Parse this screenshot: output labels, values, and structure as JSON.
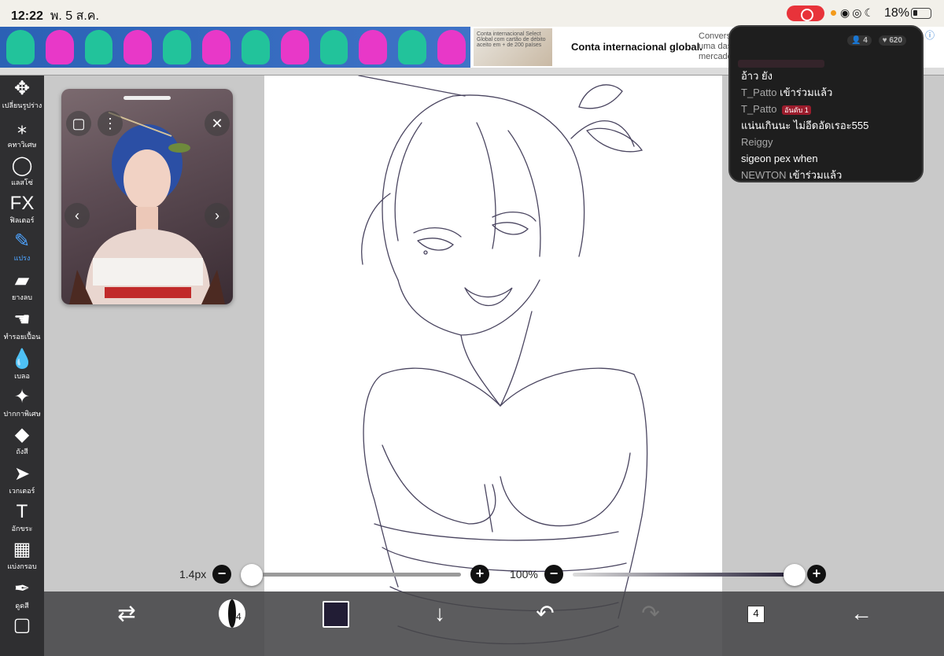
{
  "status_bar": {
    "time": "12:22",
    "date": "พ. 5 ส.ค.",
    "battery": "18%",
    "icons": [
      "record-icon",
      "wifi-icon",
      "lock-rotation-icon",
      "moon-icon",
      "battery-icon"
    ]
  },
  "ad": {
    "thumb_text": "Conta internacional Select Global com cartão de débito aceito em + de 200 países",
    "title": "Conta internacional global.",
    "subtitle": "Conversa uma das mercado",
    "gummy_colors": [
      "#22c39b",
      "#e838c8",
      "#22c39b",
      "#e838c8",
      "#22c39b",
      "#e838c8",
      "#22c39b",
      "#e838c8",
      "#22c39b",
      "#e838c8",
      "#22c39b",
      "#e838c8"
    ]
  },
  "toolbar": {
    "tools": [
      {
        "label": "เปลี่ยนรูปร่าง",
        "glyph": "✥",
        "icon": "move-icon"
      },
      {
        "label": "คทาวิเศษ",
        "glyph": "⁎",
        "icon": "magic-wand-icon"
      },
      {
        "label": "แลสโซ่",
        "glyph": "◯",
        "icon": "lasso-icon"
      },
      {
        "label": "ฟิลเตอร์",
        "glyph": "FX",
        "icon": "fx-icon"
      },
      {
        "label": "แปรง",
        "glyph": "✎",
        "icon": "brush-icon",
        "active": true
      },
      {
        "label": "ยางลบ",
        "glyph": "▰",
        "icon": "eraser-icon"
      },
      {
        "label": "ทำรอยเปื้อน",
        "glyph": "☚",
        "icon": "smudge-icon"
      },
      {
        "label": "เบลอ",
        "glyph": "💧",
        "icon": "blur-icon"
      },
      {
        "label": "ปากกาพิเศษ",
        "glyph": "✦",
        "icon": "special-pen-icon"
      },
      {
        "label": "ถังสี",
        "glyph": "◆",
        "icon": "bucket-icon"
      },
      {
        "label": "เวกเตอร์",
        "glyph": "➤",
        "icon": "vector-icon"
      },
      {
        "label": "อักขระ",
        "glyph": "T",
        "icon": "text-icon"
      },
      {
        "label": "แบ่งกรอบ",
        "glyph": "▦",
        "icon": "frame-divider-icon"
      },
      {
        "label": "ดูดสี",
        "glyph": "✒",
        "icon": "eyedropper-icon"
      },
      {
        "label": "",
        "glyph": "▢",
        "icon": "canvas-icon"
      }
    ]
  },
  "sliders": {
    "brush_size": "1.4px",
    "brush_size_fraction": 0.0,
    "opacity": "100%",
    "opacity_fraction": 1.0
  },
  "bottom_bar": {
    "brush_size_value": "1.4",
    "layer_count": "4",
    "color": "#221d35"
  },
  "chat": {
    "viewers": "4",
    "likes": "620",
    "messages": [
      {
        "user": "",
        "text": "อ้าว ยัง"
      },
      {
        "user": "T_Patto",
        "text": "เข้าร่วมแล้ว"
      },
      {
        "user": "T_Patto",
        "badge": "อันดับ 1",
        "text": ""
      },
      {
        "user": "",
        "text": "แน่นเกินนะ ไม่อีดอัดเรอะ555"
      },
      {
        "user": "Reiggy",
        "text": ""
      },
      {
        "user": "",
        "text": "sigeon pex when"
      },
      {
        "user": "NEWTON",
        "text": "เข้าร่วมแล้ว"
      }
    ]
  }
}
